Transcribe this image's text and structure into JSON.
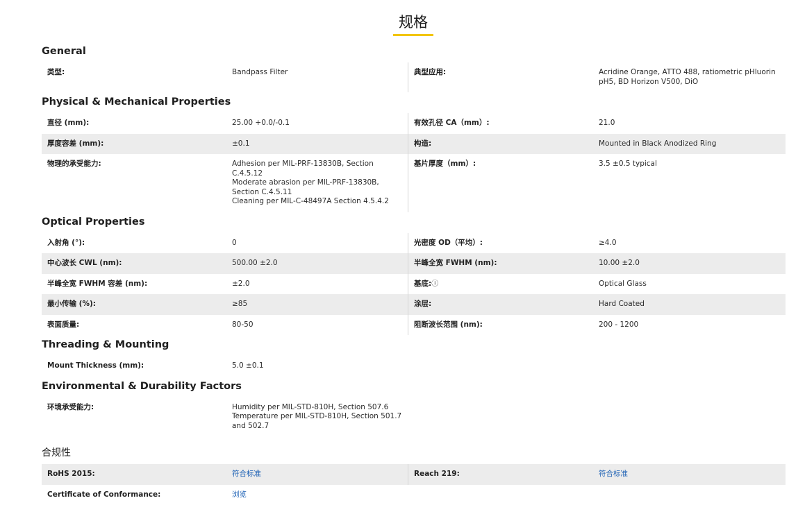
{
  "page_title": "规格",
  "sections": {
    "general": {
      "title": "General",
      "rows": [
        {
          "l1": "类型:",
          "v1": "Bandpass Filter",
          "l2": "典型应用:",
          "v2": "Acridine Orange, ATTO 488, ratiometric pHluorin pH5, BD Horizon V500, DiO"
        }
      ]
    },
    "physical": {
      "title": "Physical & Mechanical Properties",
      "rows": [
        {
          "l1": "直径 (mm):",
          "v1": "25.00 +0.0/-0.1",
          "l2": "有效孔径 CA（mm）:",
          "v2": "21.0"
        },
        {
          "l1": "厚度容差 (mm):",
          "v1": "±0.1",
          "l2": "构造:",
          "v2": "Mounted in Black Anodized Ring"
        },
        {
          "l1": "物理的承受能力:",
          "v1": "Adhesion per MIL-PRF-13830B, Section C.4.5.12\nModerate abrasion per MIL-PRF-13830B, Section C.4.5.11\nCleaning per MIL-C-48497A Section 4.5.4.2",
          "l2": "基片厚度（mm）:",
          "v2": "3.5 ±0.5 typical"
        }
      ]
    },
    "optical": {
      "title": "Optical Properties",
      "rows": [
        {
          "l1": "入射角 (°):",
          "v1": "0",
          "l2": "光密度 OD（平均）:",
          "v2": "≥4.0"
        },
        {
          "l1": "中心波长 CWL (nm):",
          "v1": "500.00 ±2.0",
          "l2": "半峰全宽 FWHM (nm):",
          "v2": "10.00 ±2.0"
        },
        {
          "l1": "半峰全宽 FWHM 容差 (nm):",
          "v1": "±2.0",
          "l2": "基底:",
          "v2": "Optical Glass"
        },
        {
          "l1": "最小传输 (%):",
          "v1": "≥85",
          "l2": "涂层:",
          "v2": "Hard Coated"
        },
        {
          "l1": "表面质量:",
          "v1": "80-50",
          "l2": "阻断波长范围 (nm):",
          "v2": "200 - 1200"
        }
      ]
    },
    "threading": {
      "title": "Threading & Mounting",
      "rows": [
        {
          "l1": "Mount Thickness (mm):",
          "v1": "5.0 ±0.1"
        }
      ]
    },
    "environmental": {
      "title": "Environmental & Durability Factors",
      "rows": [
        {
          "l1": "环境承受能力:",
          "v1": "Humidity per MIL-STD-810H, Section 507.6\nTemperature per MIL-STD-810H, Section 501.7 and 502.7"
        }
      ]
    },
    "compliance": {
      "title": "合规性",
      "rows": [
        {
          "l1": "RoHS 2015:",
          "v1": "符合标准",
          "l2": "Reach 219:",
          "v2": "符合标准"
        },
        {
          "l1": "Certificate of Conformance:",
          "v1": "浏览"
        }
      ]
    }
  },
  "info_icon": "ⓘ",
  "colors": {
    "accent_underline": "#f2c500",
    "link": "#1a5fb4",
    "row_shade": "#ececec"
  }
}
